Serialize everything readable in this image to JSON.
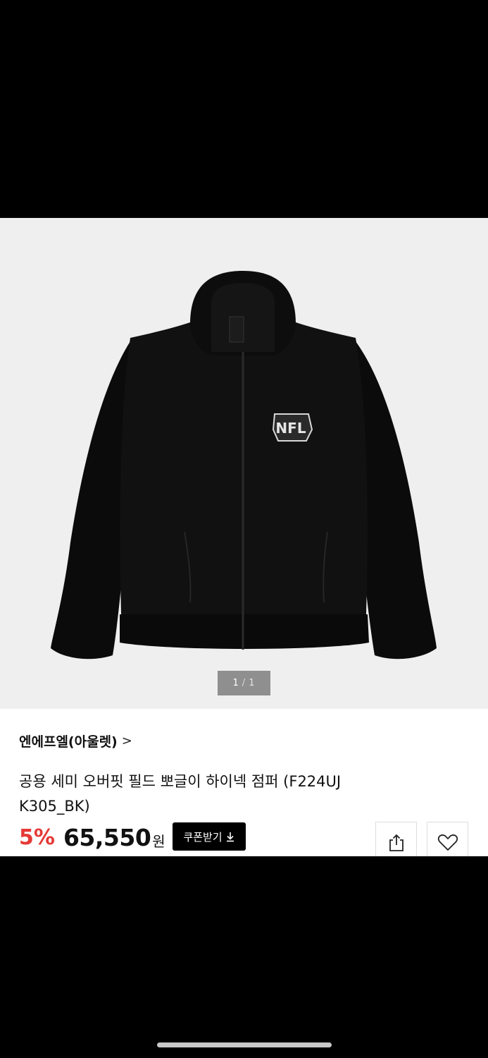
{
  "gallery": {
    "image_alt": "black sherpa fleece high-neck jumper",
    "logo_text": "NFL",
    "pager": {
      "current": "1",
      "separator": "/",
      "total": "1"
    }
  },
  "product": {
    "brand": "엔에프엘(아울렛)",
    "brand_chevron": ">",
    "title": "공용 세미 오버핏 필드 뽀글이 하이넥 점퍼 (F224UJ K305_BK)",
    "discount": "5%",
    "price": "65,550",
    "currency": "원",
    "coupon_label": "쿠폰받기"
  },
  "icons": {
    "share": "share-icon",
    "like": "heart-icon",
    "download": "download-icon"
  },
  "colors": {
    "discount": "#e53935",
    "coupon_bg": "#000000",
    "gallery_bg": "#efefef"
  }
}
